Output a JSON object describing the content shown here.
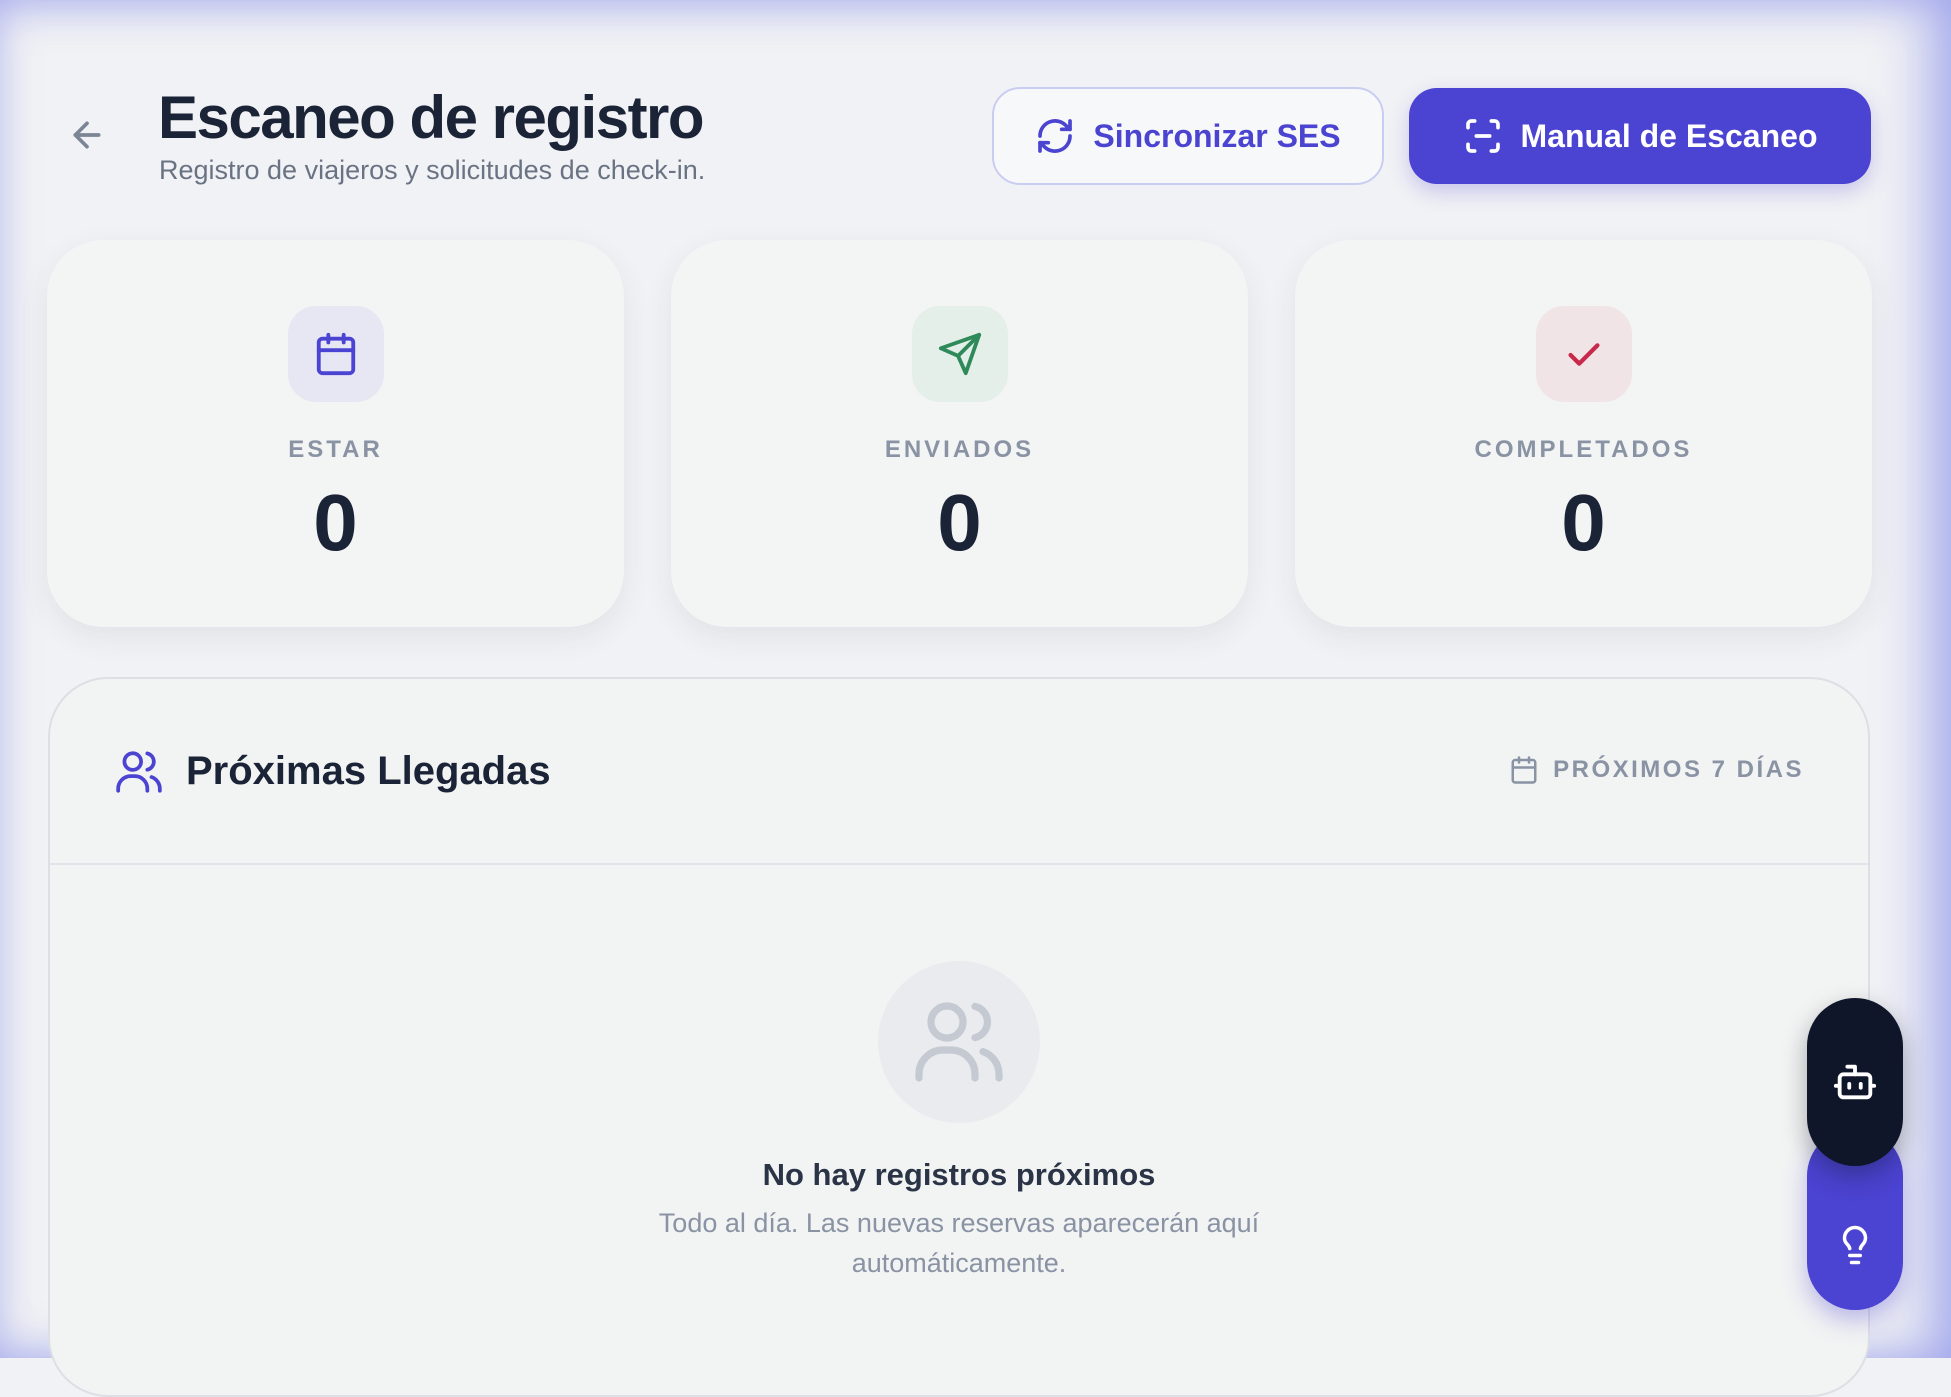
{
  "header": {
    "title": "Escaneo de registro",
    "subtitle": "Registro de viajeros y solicitudes de check-in.",
    "back_icon": "arrow-left-icon",
    "sync_button": {
      "label": "Sincronizar SES",
      "icon": "refresh-icon"
    },
    "manual_button": {
      "label": "Manual de Escaneo",
      "icon": "scan-icon"
    }
  },
  "stats": [
    {
      "label": "ESTAR",
      "value": "0",
      "icon": "calendar-icon",
      "icon_color": "#4b43d1",
      "icon_bg": "#e6e7f3"
    },
    {
      "label": "ENVIADOS",
      "value": "0",
      "icon": "send-icon",
      "icon_color": "#2f8a5a",
      "icon_bg": "#e3efe8"
    },
    {
      "label": "COMPLETADOS",
      "value": "0",
      "icon": "check-icon",
      "icon_color": "#c8284a",
      "icon_bg": "#f1e4e6"
    }
  ],
  "upcoming": {
    "title": "Próximas Llegadas",
    "title_icon": "users-icon",
    "range_label": "PRÓXIMOS 7 DÍAS",
    "range_icon": "calendar-icon",
    "empty_icon": "users-icon",
    "empty_title": "No hay registros próximos",
    "empty_text": "Todo al día. Las nuevas reservas aparecerán aquí automáticamente."
  },
  "floating": {
    "bot_icon": "robot-icon",
    "bulb_icon": "lightbulb-icon"
  },
  "colors": {
    "accent": "#4b43d1",
    "text_dark": "#1b2336",
    "muted": "#8a93a4",
    "background": "#f1f2f5"
  }
}
